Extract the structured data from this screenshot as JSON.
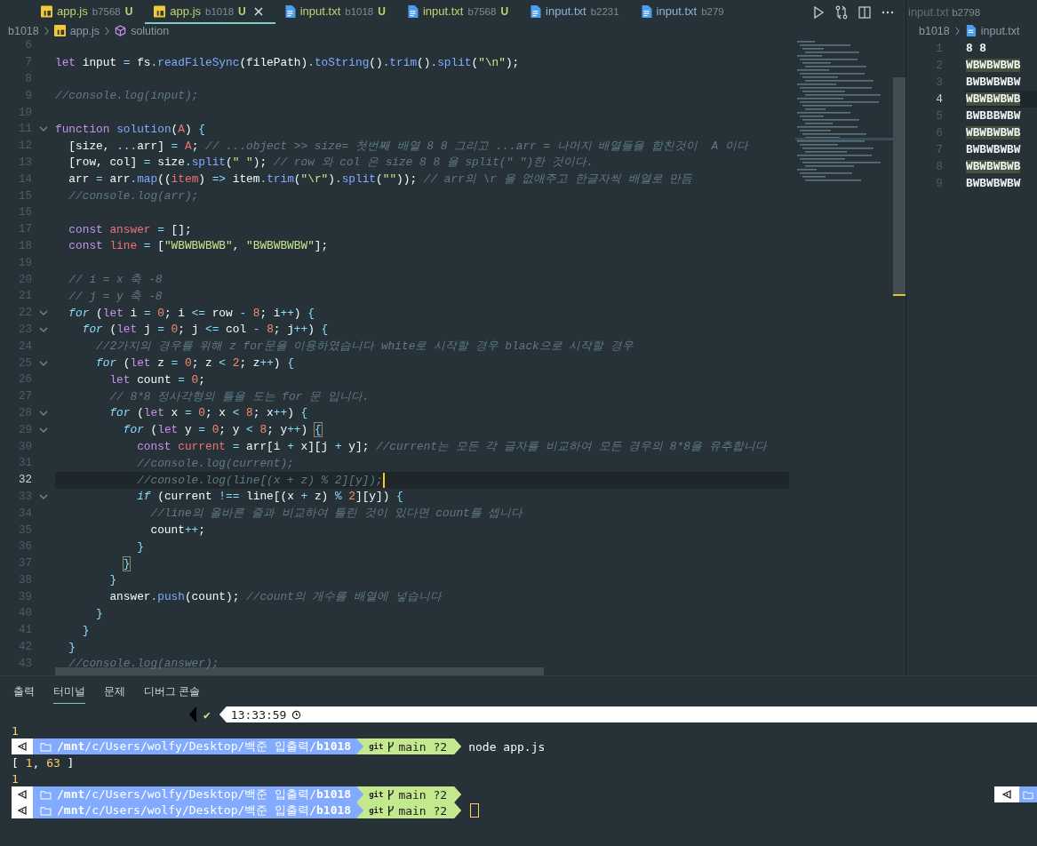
{
  "tabs": [
    {
      "kind": "js",
      "label": "app.js",
      "desc": "b7568",
      "badge": "U",
      "untracked": true,
      "selected": false
    },
    {
      "kind": "js",
      "label": "app.js",
      "desc": "b1018",
      "badge": "U",
      "untracked": true,
      "selected": true
    },
    {
      "kind": "txt",
      "label": "input.txt",
      "desc": "b1018",
      "badge": "U",
      "untracked": true,
      "selected": false
    },
    {
      "kind": "txt",
      "label": "input.txt",
      "desc": "b7568",
      "badge": "U",
      "untracked": true,
      "selected": false
    },
    {
      "kind": "txt",
      "label": "input.txt",
      "desc": "b2231",
      "untracked": false,
      "selected": false
    },
    {
      "kind": "txt",
      "label": "input.txt",
      "desc": "b279",
      "untracked": false,
      "selected": false
    }
  ],
  "breadcrumb": {
    "folder": "b1018",
    "file": "app.js",
    "symbol": "solution"
  },
  "editor": {
    "lines": [
      {
        "number": "6",
        "fold": false,
        "current": false
      },
      {
        "number": "7",
        "fold": false,
        "current": false,
        "tokens": [
          {
            "kind": "kw",
            "text": "let"
          },
          {
            "kind": "plain",
            "text": " input "
          },
          {
            "kind": "op",
            "text": "="
          },
          {
            "kind": "plain",
            "text": " fs"
          },
          {
            "kind": "op",
            "text": "."
          },
          {
            "kind": "fn",
            "text": "readFileSync"
          },
          {
            "kind": "plain",
            "text": "(filePath)"
          },
          {
            "kind": "op",
            "text": "."
          },
          {
            "kind": "fn",
            "text": "toString"
          },
          {
            "kind": "plain",
            "text": "()"
          },
          {
            "kind": "op",
            "text": "."
          },
          {
            "kind": "fn",
            "text": "trim"
          },
          {
            "kind": "plain",
            "text": "()"
          },
          {
            "kind": "op",
            "text": "."
          },
          {
            "kind": "fn",
            "text": "split"
          },
          {
            "kind": "plain",
            "text": "("
          },
          {
            "kind": "str",
            "text": "\"\\n\""
          },
          {
            "kind": "plain",
            "text": ");"
          }
        ]
      },
      {
        "number": "8",
        "fold": false,
        "current": false
      },
      {
        "number": "9",
        "fold": false,
        "current": false,
        "tokens": [
          {
            "kind": "cm",
            "text": "//console.log(input);"
          }
        ]
      },
      {
        "number": "10",
        "fold": false,
        "current": false
      },
      {
        "number": "11",
        "fold": true,
        "current": false,
        "tokens": [
          {
            "kind": "kw",
            "text": "function "
          },
          {
            "kind": "fn",
            "text": "solution"
          },
          {
            "kind": "plain",
            "text": "("
          },
          {
            "kind": "prm",
            "text": "A"
          },
          {
            "kind": "plain",
            "text": ") "
          },
          {
            "kind": "op",
            "text": "{"
          }
        ]
      },
      {
        "number": "12",
        "fold": false,
        "current": false,
        "tokens": [
          {
            "kind": "plain",
            "text": "  [size, "
          },
          {
            "kind": "op",
            "text": "..."
          },
          {
            "kind": "plain",
            "text": "arr] "
          },
          {
            "kind": "op",
            "text": "= "
          },
          {
            "kind": "prm",
            "text": "A"
          },
          {
            "kind": "plain",
            "text": "; "
          },
          {
            "kind": "cm",
            "text": "// ...object >> size= 첫번째 배열 8 8 그리고 ...arr = 나머지 배열들을 합친것이  A 이다"
          }
        ]
      },
      {
        "number": "13",
        "fold": false,
        "current": false,
        "tokens": [
          {
            "kind": "plain",
            "text": "  [row, col] "
          },
          {
            "kind": "op",
            "text": "="
          },
          {
            "kind": "plain",
            "text": " size"
          },
          {
            "kind": "op",
            "text": "."
          },
          {
            "kind": "fn",
            "text": "split"
          },
          {
            "kind": "plain",
            "text": "("
          },
          {
            "kind": "str",
            "text": "\" \""
          },
          {
            "kind": "plain",
            "text": "); "
          },
          {
            "kind": "cm",
            "text": "// row 와 col 은 size 8 8 을 split(\" \")한 것이다."
          }
        ]
      },
      {
        "number": "14",
        "fold": false,
        "current": false,
        "tokens": [
          {
            "kind": "plain",
            "text": "  arr "
          },
          {
            "kind": "op",
            "text": "="
          },
          {
            "kind": "plain",
            "text": " arr"
          },
          {
            "kind": "op",
            "text": "."
          },
          {
            "kind": "fn",
            "text": "map"
          },
          {
            "kind": "plain",
            "text": "(("
          },
          {
            "kind": "prm",
            "text": "item"
          },
          {
            "kind": "plain",
            "text": ") "
          },
          {
            "kind": "op",
            "text": "=>"
          },
          {
            "kind": "plain",
            "text": " item"
          },
          {
            "kind": "op",
            "text": "."
          },
          {
            "kind": "fn",
            "text": "trim"
          },
          {
            "kind": "plain",
            "text": "("
          },
          {
            "kind": "str",
            "text": "\"\\r\""
          },
          {
            "kind": "plain",
            "text": ")"
          },
          {
            "kind": "op",
            "text": "."
          },
          {
            "kind": "fn",
            "text": "split"
          },
          {
            "kind": "plain",
            "text": "("
          },
          {
            "kind": "str",
            "text": "\"\""
          },
          {
            "kind": "plain",
            "text": ")); "
          },
          {
            "kind": "cm",
            "text": "// arr의 \\r 을 없애주고 한글자씩 배열로 만듬"
          }
        ]
      },
      {
        "number": "15",
        "fold": false,
        "current": false,
        "tokens": [
          {
            "kind": "cm",
            "text": "  //console.log(arr);"
          }
        ]
      },
      {
        "number": "16",
        "fold": false,
        "current": false
      },
      {
        "number": "17",
        "fold": false,
        "current": false,
        "tokens": [
          {
            "kind": "kw",
            "text": "  const "
          },
          {
            "kind": "prm",
            "text": "answer"
          },
          {
            "kind": "op",
            "text": " = "
          },
          {
            "kind": "plain",
            "text": "[];"
          }
        ]
      },
      {
        "number": "18",
        "fold": false,
        "current": false,
        "tokens": [
          {
            "kind": "kw",
            "text": "  const "
          },
          {
            "kind": "prm",
            "text": "line"
          },
          {
            "kind": "op",
            "text": " = "
          },
          {
            "kind": "plain",
            "text": "["
          },
          {
            "kind": "str",
            "text": "\"WBWBWBWB\""
          },
          {
            "kind": "plain",
            "text": ", "
          },
          {
            "kind": "str",
            "text": "\"BWBWBWBW\""
          },
          {
            "kind": "plain",
            "text": "];"
          }
        ]
      },
      {
        "number": "19",
        "fold": false,
        "current": false
      },
      {
        "number": "20",
        "fold": false,
        "current": false,
        "tokens": [
          {
            "kind": "cm",
            "text": "  // i = x 축 -8"
          }
        ]
      },
      {
        "number": "21",
        "fold": false,
        "current": false,
        "tokens": [
          {
            "kind": "cm",
            "text": "  // j = y 축 -8"
          }
        ]
      },
      {
        "number": "22",
        "fold": true,
        "current": false,
        "tokens": [
          {
            "kind": "ctl",
            "text": "  for"
          },
          {
            "kind": "plain",
            "text": " ("
          },
          {
            "kind": "kw",
            "text": "let"
          },
          {
            "kind": "plain",
            "text": " i "
          },
          {
            "kind": "op",
            "text": "= "
          },
          {
            "kind": "num",
            "text": "0"
          },
          {
            "kind": "plain",
            "text": "; i "
          },
          {
            "kind": "op",
            "text": "<="
          },
          {
            "kind": "plain",
            "text": " row "
          },
          {
            "kind": "op",
            "text": "- "
          },
          {
            "kind": "num",
            "text": "8"
          },
          {
            "kind": "plain",
            "text": "; i"
          },
          {
            "kind": "op",
            "text": "++"
          },
          {
            "kind": "plain",
            "text": ") "
          },
          {
            "kind": "op",
            "text": "{"
          }
        ]
      },
      {
        "number": "23",
        "fold": true,
        "current": false,
        "tokens": [
          {
            "kind": "ctl",
            "text": "    for"
          },
          {
            "kind": "plain",
            "text": " ("
          },
          {
            "kind": "kw",
            "text": "let"
          },
          {
            "kind": "plain",
            "text": " j "
          },
          {
            "kind": "op",
            "text": "= "
          },
          {
            "kind": "num",
            "text": "0"
          },
          {
            "kind": "plain",
            "text": "; j "
          },
          {
            "kind": "op",
            "text": "<="
          },
          {
            "kind": "plain",
            "text": " col "
          },
          {
            "kind": "op",
            "text": "- "
          },
          {
            "kind": "num",
            "text": "8"
          },
          {
            "kind": "plain",
            "text": "; j"
          },
          {
            "kind": "op",
            "text": "++"
          },
          {
            "kind": "plain",
            "text": ") "
          },
          {
            "kind": "op",
            "text": "{"
          }
        ]
      },
      {
        "number": "24",
        "fold": false,
        "current": false,
        "tokens": [
          {
            "kind": "cm",
            "text": "      //2가지의 경우를 위해 z for문을 이용하였습니다 white로 시작할 경우 black으로 시작할 경우"
          }
        ]
      },
      {
        "number": "25",
        "fold": true,
        "current": false,
        "tokens": [
          {
            "kind": "ctl",
            "text": "      for"
          },
          {
            "kind": "plain",
            "text": " ("
          },
          {
            "kind": "kw",
            "text": "let"
          },
          {
            "kind": "plain",
            "text": " z "
          },
          {
            "kind": "op",
            "text": "= "
          },
          {
            "kind": "num",
            "text": "0"
          },
          {
            "kind": "plain",
            "text": "; z "
          },
          {
            "kind": "op",
            "text": "< "
          },
          {
            "kind": "num",
            "text": "2"
          },
          {
            "kind": "plain",
            "text": "; z"
          },
          {
            "kind": "op",
            "text": "++"
          },
          {
            "kind": "plain",
            "text": ") "
          },
          {
            "kind": "op",
            "text": "{"
          }
        ]
      },
      {
        "number": "26",
        "fold": false,
        "current": false,
        "tokens": [
          {
            "kind": "kw",
            "text": "        let"
          },
          {
            "kind": "plain",
            "text": " count "
          },
          {
            "kind": "op",
            "text": "= "
          },
          {
            "kind": "num",
            "text": "0"
          },
          {
            "kind": "plain",
            "text": ";"
          }
        ]
      },
      {
        "number": "27",
        "fold": false,
        "current": false,
        "tokens": [
          {
            "kind": "cm",
            "text": "        // 8*8 정사각형의 틀을 도는 for 문 입니다."
          }
        ]
      },
      {
        "number": "28",
        "fold": true,
        "current": false,
        "tokens": [
          {
            "kind": "ctl",
            "text": "        for"
          },
          {
            "kind": "plain",
            "text": " ("
          },
          {
            "kind": "kw",
            "text": "let"
          },
          {
            "kind": "plain",
            "text": " x "
          },
          {
            "kind": "op",
            "text": "= "
          },
          {
            "kind": "num",
            "text": "0"
          },
          {
            "kind": "plain",
            "text": "; x "
          },
          {
            "kind": "op",
            "text": "< "
          },
          {
            "kind": "num",
            "text": "8"
          },
          {
            "kind": "plain",
            "text": "; x"
          },
          {
            "kind": "op",
            "text": "++"
          },
          {
            "kind": "plain",
            "text": ") "
          },
          {
            "kind": "op",
            "text": "{"
          }
        ]
      },
      {
        "number": "29",
        "fold": true,
        "current": false,
        "tokens": [
          {
            "kind": "ctl",
            "text": "          for"
          },
          {
            "kind": "plain",
            "text": " ("
          },
          {
            "kind": "kw",
            "text": "let"
          },
          {
            "kind": "plain",
            "text": " y "
          },
          {
            "kind": "op",
            "text": "= "
          },
          {
            "kind": "num",
            "text": "0"
          },
          {
            "kind": "plain",
            "text": "; y "
          },
          {
            "kind": "op",
            "text": "< "
          },
          {
            "kind": "num",
            "text": "8"
          },
          {
            "kind": "plain",
            "text": "; y"
          },
          {
            "kind": "op",
            "text": "++"
          },
          {
            "kind": "plain",
            "text": ") "
          },
          {
            "kind": "match",
            "text": "{"
          }
        ]
      },
      {
        "number": "30",
        "fold": false,
        "current": false,
        "tokens": [
          {
            "kind": "kw",
            "text": "            const "
          },
          {
            "kind": "prm",
            "text": "current"
          },
          {
            "kind": "op",
            "text": " = "
          },
          {
            "kind": "plain",
            "text": "arr[i "
          },
          {
            "kind": "op",
            "text": "+"
          },
          {
            "kind": "plain",
            "text": " x][j "
          },
          {
            "kind": "op",
            "text": "+"
          },
          {
            "kind": "plain",
            "text": " y]; "
          },
          {
            "kind": "cm",
            "text": "//current는 모든 각 글자를 비교하여 모든 경우의 8*8을 유추합니다"
          }
        ]
      },
      {
        "number": "31",
        "fold": false,
        "current": false,
        "tokens": [
          {
            "kind": "cm",
            "text": "            //console.log(current);"
          }
        ]
      },
      {
        "number": "32",
        "fold": false,
        "current": true,
        "tokens": [
          {
            "kind": "cm",
            "text": "            //console.log(line[(x + z) % 2][y]);"
          }
        ]
      },
      {
        "number": "33",
        "fold": true,
        "current": false,
        "tokens": [
          {
            "kind": "ctl",
            "text": "            if"
          },
          {
            "kind": "plain",
            "text": " (current "
          },
          {
            "kind": "op",
            "text": "!=="
          },
          {
            "kind": "plain",
            "text": " line[(x "
          },
          {
            "kind": "op",
            "text": "+"
          },
          {
            "kind": "plain",
            "text": " z) "
          },
          {
            "kind": "op",
            "text": "% "
          },
          {
            "kind": "num",
            "text": "2"
          },
          {
            "kind": "plain",
            "text": "][y]) "
          },
          {
            "kind": "op",
            "text": "{"
          }
        ]
      },
      {
        "number": "34",
        "fold": false,
        "current": false,
        "tokens": [
          {
            "kind": "cm",
            "text": "              //line의 올바른 줄과 비교하여 틀린 것이 있다면 count를 셉니다"
          }
        ]
      },
      {
        "number": "35",
        "fold": false,
        "current": false,
        "tokens": [
          {
            "kind": "plain",
            "text": "              count"
          },
          {
            "kind": "op",
            "text": "++"
          },
          {
            "kind": "plain",
            "text": ";"
          }
        ]
      },
      {
        "number": "36",
        "fold": false,
        "current": false,
        "tokens": [
          {
            "kind": "op",
            "text": "            }"
          }
        ]
      },
      {
        "number": "37",
        "fold": false,
        "current": false,
        "tokens": [
          {
            "kind": "match",
            "text": "          }"
          }
        ]
      },
      {
        "number": "38",
        "fold": false,
        "current": false,
        "tokens": [
          {
            "kind": "op",
            "text": "        }"
          }
        ]
      },
      {
        "number": "39",
        "fold": false,
        "current": false,
        "tokens": [
          {
            "kind": "plain",
            "text": "        answer"
          },
          {
            "kind": "op",
            "text": "."
          },
          {
            "kind": "fn",
            "text": "push"
          },
          {
            "kind": "plain",
            "text": "(count); "
          },
          {
            "kind": "cm",
            "text": "//count의 개수를 배열에 넣습니다"
          }
        ]
      },
      {
        "number": "40",
        "fold": false,
        "current": false,
        "tokens": [
          {
            "kind": "op",
            "text": "      }"
          }
        ]
      },
      {
        "number": "41",
        "fold": false,
        "current": false,
        "tokens": [
          {
            "kind": "op",
            "text": "    }"
          }
        ]
      },
      {
        "number": "42",
        "fold": false,
        "current": false,
        "tokens": [
          {
            "kind": "op",
            "text": "  }"
          }
        ]
      },
      {
        "number": "43",
        "fold": false,
        "current": false,
        "tokens": [
          {
            "kind": "cm",
            "text": "  //console.log(answer);"
          }
        ]
      }
    ]
  },
  "side": {
    "tab": {
      "label": "input.txt",
      "desc": "b2798"
    },
    "breadcrumb": {
      "folder": "b1018",
      "file": "input.txt"
    },
    "lines": [
      {
        "number": "1",
        "text": "8 8",
        "highlighted": false,
        "current": false
      },
      {
        "number": "2",
        "text": "WBWBWBWB",
        "highlighted": true,
        "current": false
      },
      {
        "number": "3",
        "text": "BWBWBWBW",
        "highlighted": false,
        "current": false
      },
      {
        "number": "4",
        "text": "WBWBWBWB",
        "highlighted": true,
        "current": true
      },
      {
        "number": "5",
        "text": "BWBBBWBW",
        "highlighted": false,
        "current": false
      },
      {
        "number": "6",
        "text": "WBWBWBWB",
        "highlighted": true,
        "current": false
      },
      {
        "number": "7",
        "text": "BWBWBWBW",
        "highlighted": false,
        "current": false
      },
      {
        "number": "8",
        "text": "WBWBWBWB",
        "highlighted": true,
        "current": false
      },
      {
        "number": "9",
        "text": "BWBWBWBW",
        "highlighted": false,
        "current": false
      }
    ]
  },
  "panel_tabs": [
    {
      "label": "출력",
      "selected": false
    },
    {
      "label": "터미널",
      "selected": true
    },
    {
      "label": "문제",
      "selected": false
    },
    {
      "label": "디버그 콘솔",
      "selected": false
    }
  ],
  "terminal": [
    {
      "kind": "time",
      "check": "✔",
      "time": "13:33:59"
    },
    {
      "kind": "output",
      "parts": [
        {
          "kind": "num",
          "text": "1"
        }
      ]
    },
    {
      "kind": "prompt",
      "path": "**/mnt**/c/Users/wolfy/Desktop/백준 입출력/**b1018**",
      "git": "git",
      "branch": "main ?2",
      "command": "node app.js",
      "right_prompt": false,
      "cursor": false
    },
    {
      "kind": "output",
      "parts": [
        {
          "kind": "plain",
          "text": "[ "
        },
        {
          "kind": "num",
          "text": "1"
        },
        {
          "kind": "plain",
          "text": ", "
        },
        {
          "kind": "num",
          "text": "63"
        },
        {
          "kind": "plain",
          "text": " ]"
        }
      ]
    },
    {
      "kind": "output",
      "parts": [
        {
          "kind": "num",
          "text": "1"
        }
      ]
    },
    {
      "kind": "prompt",
      "path": "**/mnt**/c/Users/wolfy/Desktop/백준 입출력/**b1018**",
      "git": "git",
      "branch": "main ?2",
      "right_prompt": true,
      "cursor": false
    },
    {
      "kind": "prompt",
      "path": "**/mnt**/c/Users/wolfy/Desktop/백준 입출력/**b1018**",
      "git": "git",
      "branch": "main ?2",
      "right_prompt": false,
      "cursor": true
    }
  ]
}
